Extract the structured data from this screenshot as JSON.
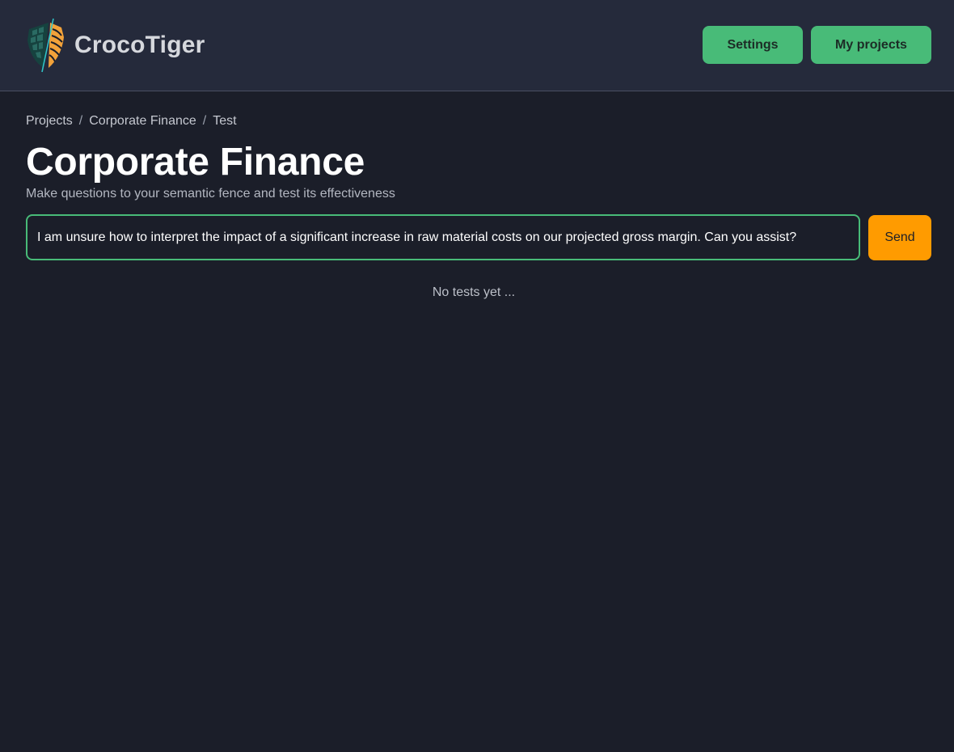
{
  "header": {
    "brand_name": "CrocoTiger",
    "logo_icon": "croco-tiger-shield-logo",
    "settings_label": "Settings",
    "projects_label": "My projects",
    "accent_color": "#48bb78"
  },
  "breadcrumb": {
    "items": [
      "Projects",
      "Corporate Finance",
      "Test"
    ],
    "separator": "/"
  },
  "main": {
    "title": "Corporate Finance",
    "subtitle": "Make questions to your semantic fence and test its effectiveness",
    "query_value": "I am unsure how to interpret the impact of a significant increase in raw material costs on our projected gross margin. Can you assist?",
    "send_label": "Send",
    "send_color": "#ff9b00",
    "empty_state": "No tests yet ..."
  }
}
